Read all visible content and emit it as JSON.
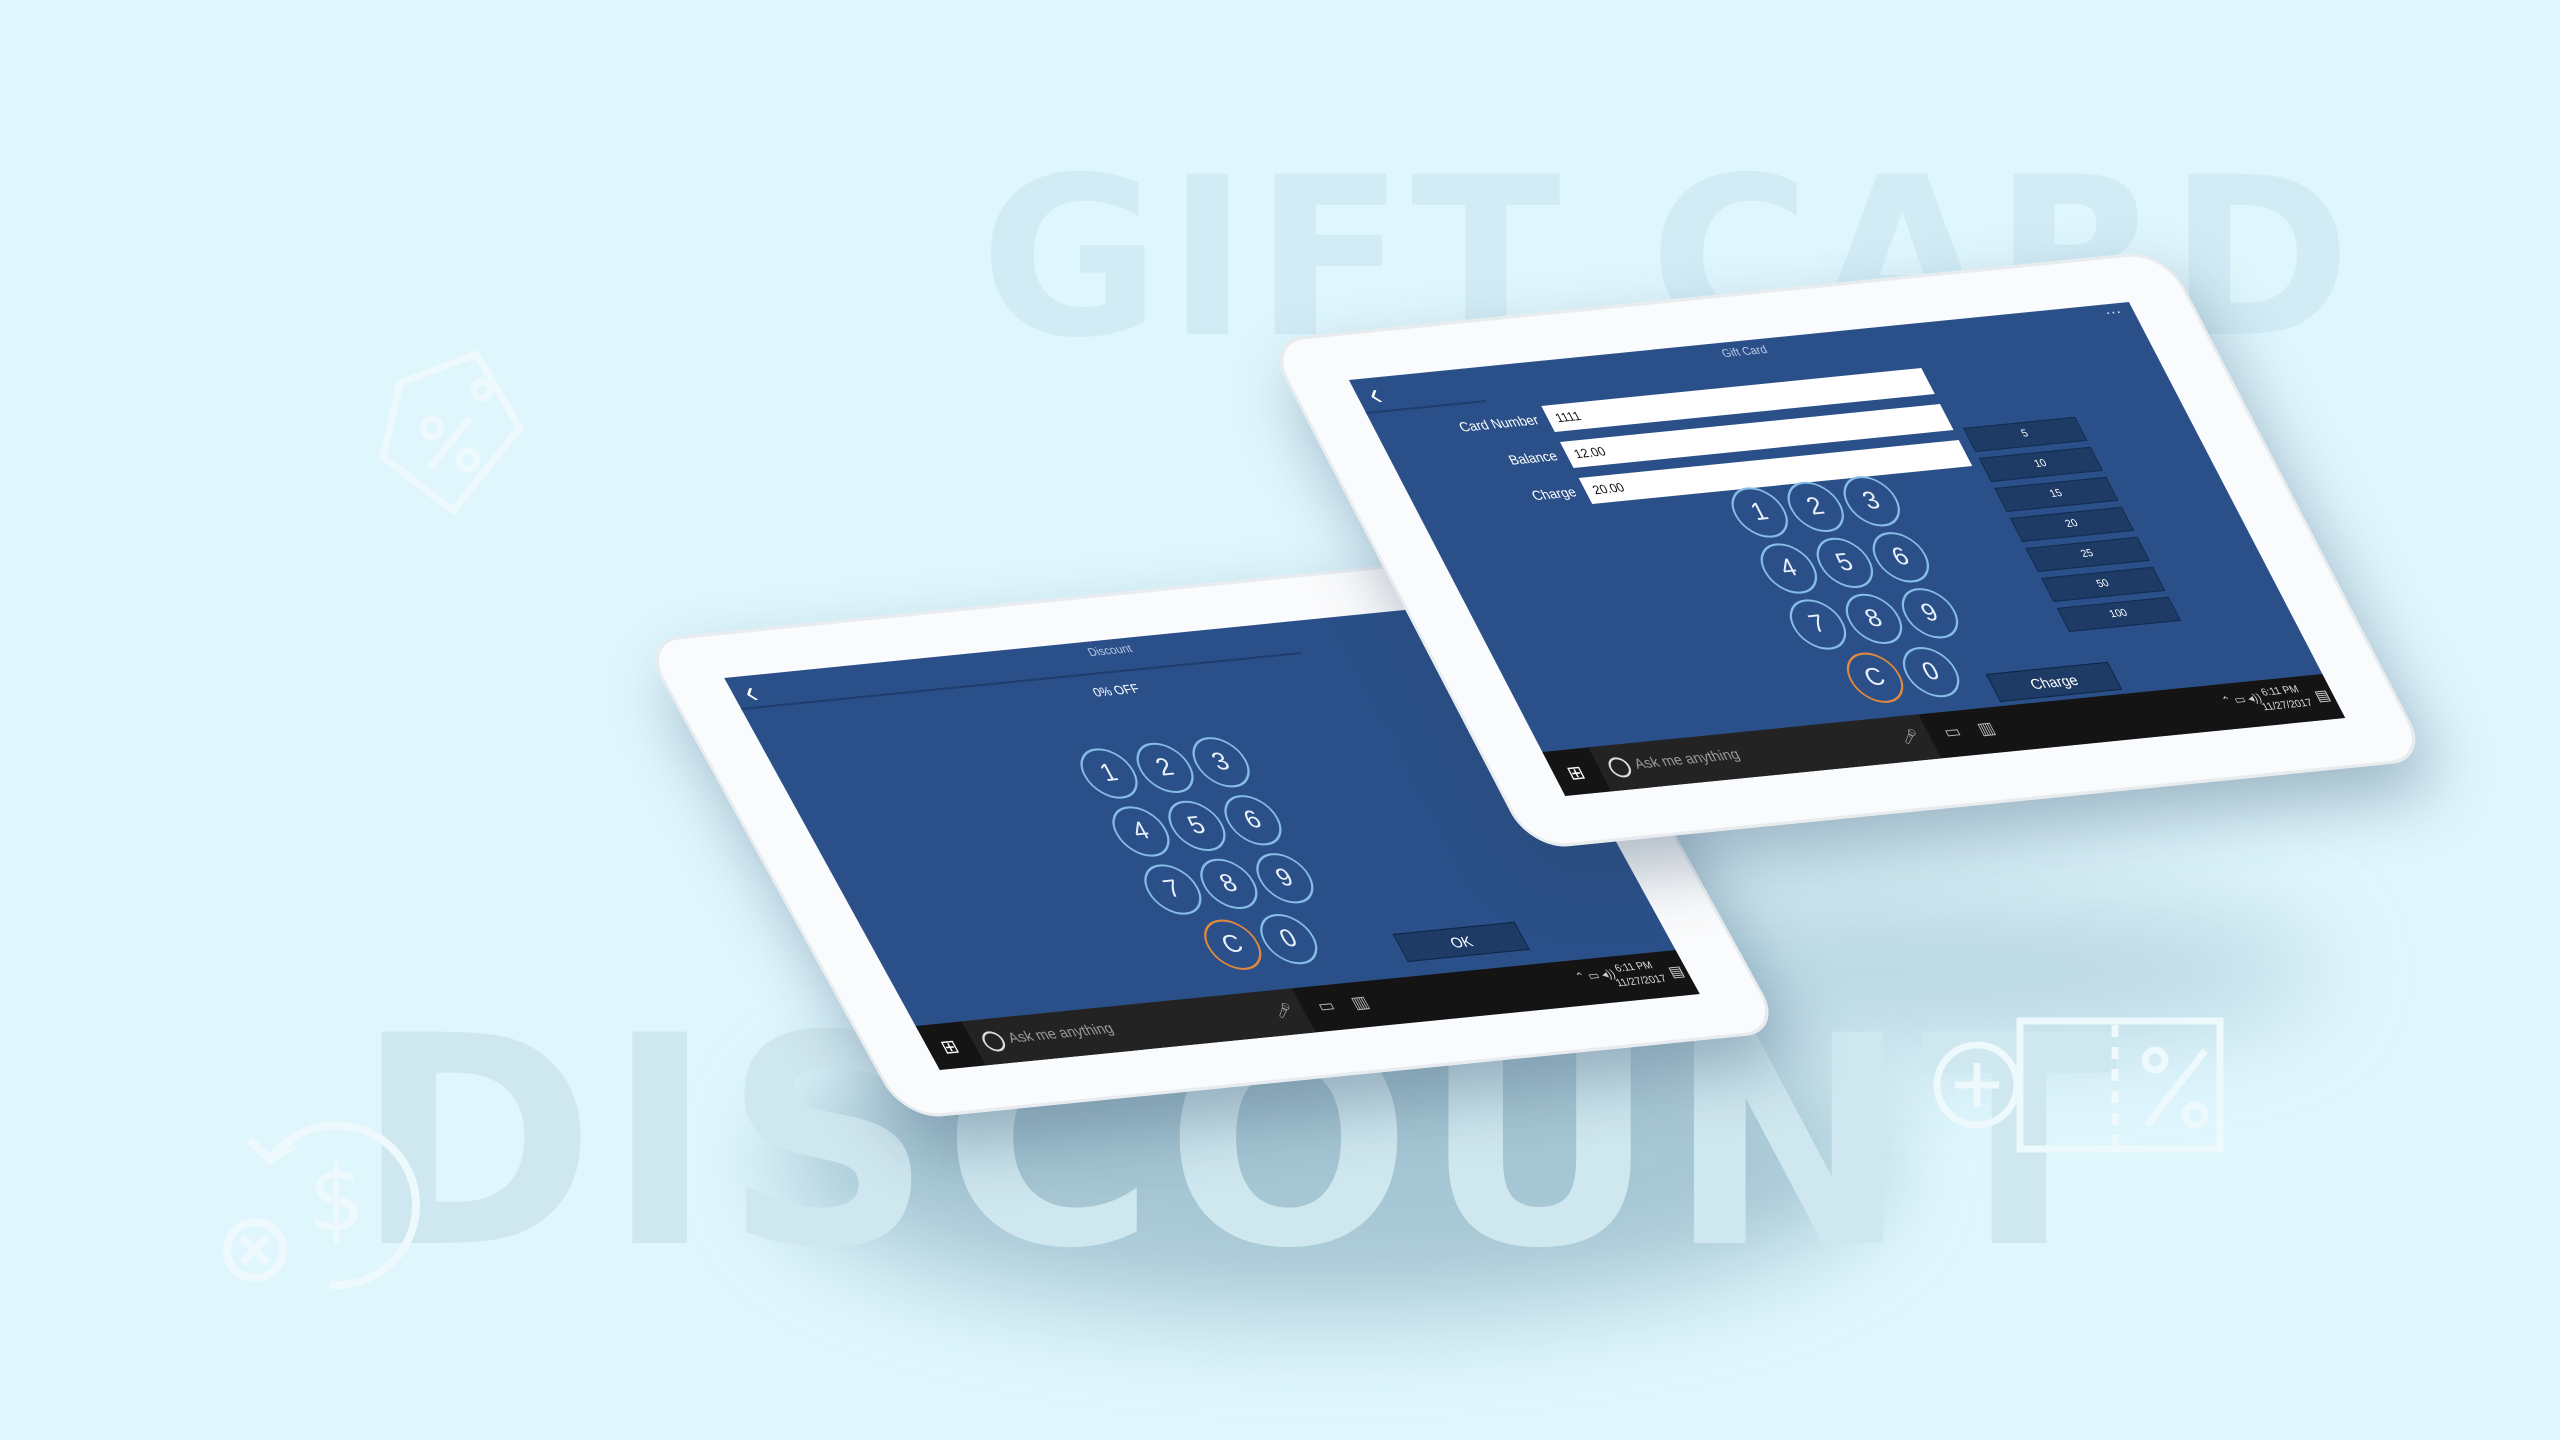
{
  "background": {
    "word_top": "GIFT CARD",
    "word_bottom": "DISCOUNT",
    "icons": [
      "price-tag-percent-icon",
      "coupon-percent-icon",
      "money-refund-icon"
    ]
  },
  "discount_screen": {
    "title": "Discount",
    "percent_label": "0% OFF",
    "keys": [
      "1",
      "2",
      "3",
      "4",
      "5",
      "6",
      "7",
      "8",
      "9",
      "C",
      "0"
    ],
    "ok_label": "OK"
  },
  "giftcard_screen": {
    "title": "Gift Card",
    "fields": [
      {
        "label": "Card Number",
        "value": "1111"
      },
      {
        "label": "Balance",
        "value": "12.00"
      },
      {
        "label": "Charge",
        "value": "20.00"
      }
    ],
    "quick_amounts": [
      "5",
      "10",
      "15",
      "20",
      "25",
      "50",
      "100"
    ],
    "keys": [
      "1",
      "2",
      "3",
      "4",
      "5",
      "6",
      "7",
      "8",
      "9",
      "C",
      "0"
    ],
    "charge_label": "Charge"
  },
  "taskbar": {
    "search_placeholder": "Ask me anything",
    "time": "6:11 PM",
    "date": "11/27/2017"
  },
  "colors": {
    "screen": "#2b5089",
    "key_border": "#86bde6",
    "clear_key": "#e3893b",
    "button": "#1e3b66",
    "page_bg": "#dff6fd"
  }
}
